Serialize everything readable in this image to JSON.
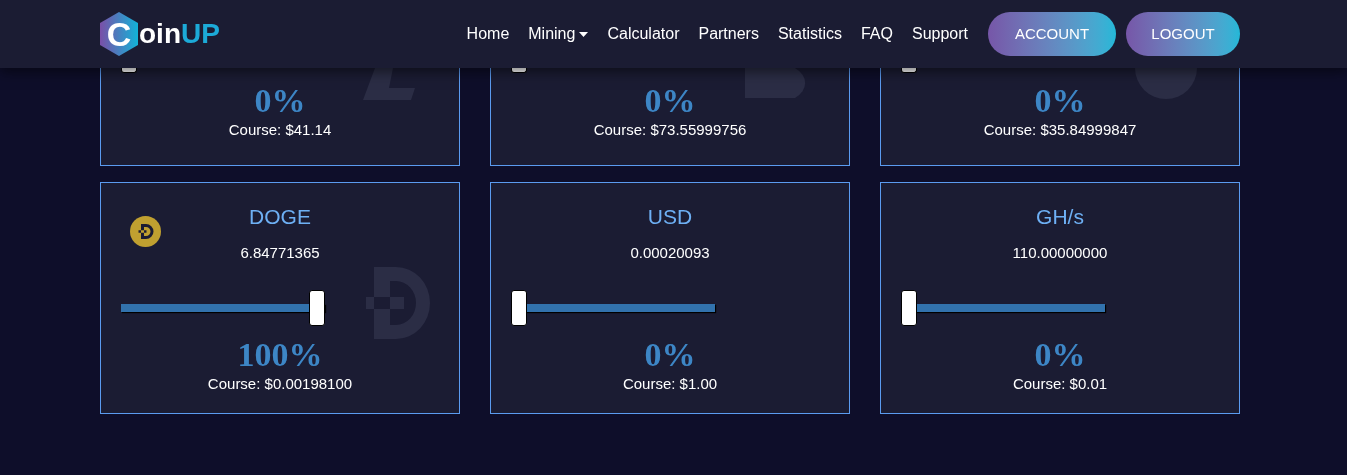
{
  "logo": {
    "letter": "C",
    "text": "oin",
    "accent": "UP"
  },
  "nav": [
    {
      "label": "Home",
      "dropdown": false
    },
    {
      "label": "Mining",
      "dropdown": true
    },
    {
      "label": "Calculator",
      "dropdown": false
    },
    {
      "label": "Partners",
      "dropdown": false
    },
    {
      "label": "Statistics",
      "dropdown": false
    },
    {
      "label": "FAQ",
      "dropdown": false
    },
    {
      "label": "Support",
      "dropdown": false
    }
  ],
  "buttons": [
    "ACCOUNT",
    "LOGOUT"
  ],
  "top_cards": [
    {
      "level": 0,
      "percent": "0%",
      "course": "Course: $41.14"
    },
    {
      "level": 0,
      "percent": "0%",
      "course": "Course: $73.55999756"
    },
    {
      "level": 0,
      "percent": "0%",
      "course": "Course: $35.84999847"
    }
  ],
  "cards": [
    {
      "title": "DOGE",
      "coin_icon": true,
      "value": "6.84771365",
      "level": 1,
      "percent": "100%",
      "course": "Course: $0.00198100"
    },
    {
      "title": "USD",
      "coin_icon": false,
      "value": "0.00020093",
      "level": 0,
      "percent": "0%",
      "course": "Course: $1.00"
    },
    {
      "title": "GH/s",
      "coin_icon": false,
      "value": "110.00000000",
      "level": 0,
      "percent": "0%",
      "course": "Course: $0.01"
    }
  ]
}
